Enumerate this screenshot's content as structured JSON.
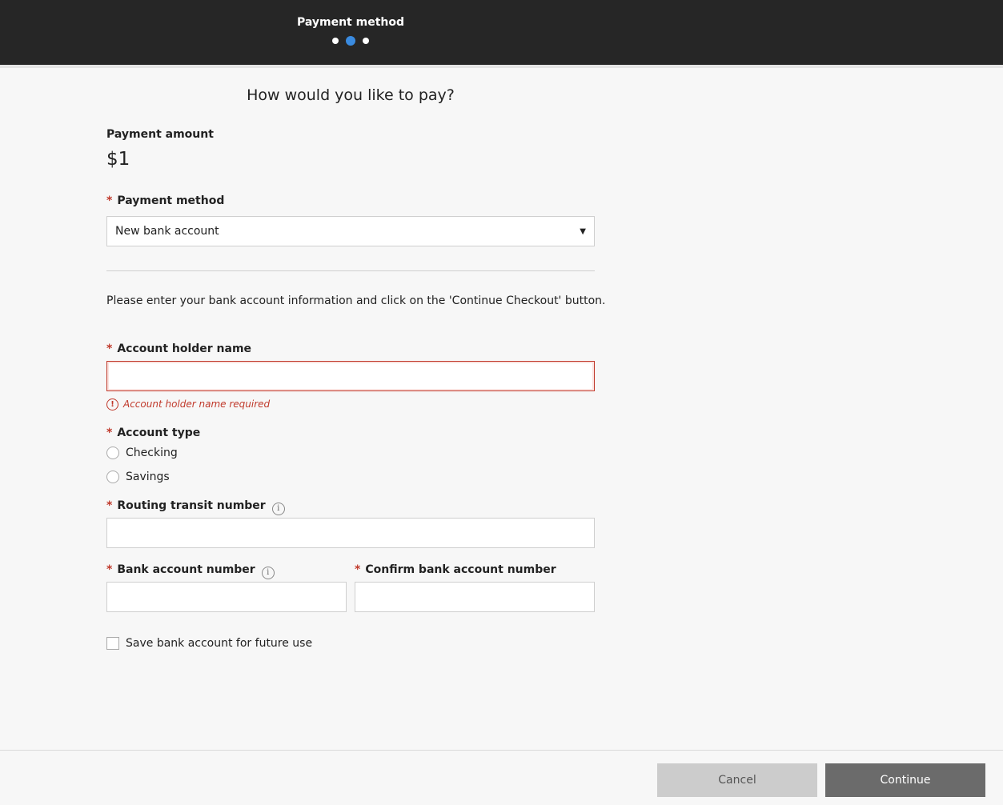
{
  "header": {
    "step_title": "Payment method",
    "steps": [
      {
        "state": "complete"
      },
      {
        "state": "active"
      },
      {
        "state": "pending"
      }
    ],
    "active_step_color": "#3a8be0"
  },
  "main": {
    "heading": "How would you like to pay?",
    "payment_amount_label": "Payment amount",
    "payment_amount_value": "$1",
    "payment_method_label": "Payment method",
    "payment_method_selected": "New bank account",
    "instructions": "Please enter your bank account information and click on the 'Continue Checkout' button.",
    "account_holder_label": "Account holder name",
    "account_holder_value": "",
    "account_holder_error": "Account holder name required",
    "account_type_label": "Account type",
    "account_type_options": [
      "Checking",
      "Savings"
    ],
    "routing_label": "Routing transit number",
    "routing_value": "",
    "bank_account_label": "Bank account number",
    "bank_account_value": "",
    "confirm_bank_account_label": "Confirm bank account number",
    "confirm_bank_account_value": "",
    "save_account_label": "Save bank account for future use",
    "required_marker": "*",
    "error_color": "#c0392b"
  },
  "footer": {
    "cancel_label": "Cancel",
    "continue_label": "Continue"
  }
}
